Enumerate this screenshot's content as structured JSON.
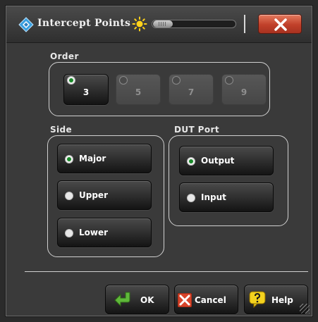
{
  "window": {
    "title": "Intercept Points"
  },
  "order": {
    "label": "Order",
    "options": [
      {
        "label": "3",
        "selected": true,
        "enabled": true
      },
      {
        "label": "5",
        "selected": false,
        "enabled": false
      },
      {
        "label": "7",
        "selected": false,
        "enabled": false
      },
      {
        "label": "9",
        "selected": false,
        "enabled": false
      }
    ]
  },
  "side": {
    "label": "Side",
    "options": [
      {
        "label": "Major",
        "selected": true
      },
      {
        "label": "Upper",
        "selected": false
      },
      {
        "label": "Lower",
        "selected": false
      }
    ]
  },
  "dut_port": {
    "label": "DUT Port",
    "options": [
      {
        "label": "Output",
        "selected": true
      },
      {
        "label": "Input",
        "selected": false
      }
    ]
  },
  "actions": {
    "ok": "OK",
    "cancel": "Cancel",
    "help": "Help"
  },
  "icons": {
    "app": "diamond-app-icon",
    "brightness": "sun-icon",
    "close": "close-x-icon",
    "ok": "green-arrow-icon",
    "cancel": "red-x-icon",
    "help": "question-icon"
  },
  "colors": {
    "background": "#3a3a3a",
    "selected_radio": "#1a8a2a",
    "close_button": "#c0402a"
  }
}
